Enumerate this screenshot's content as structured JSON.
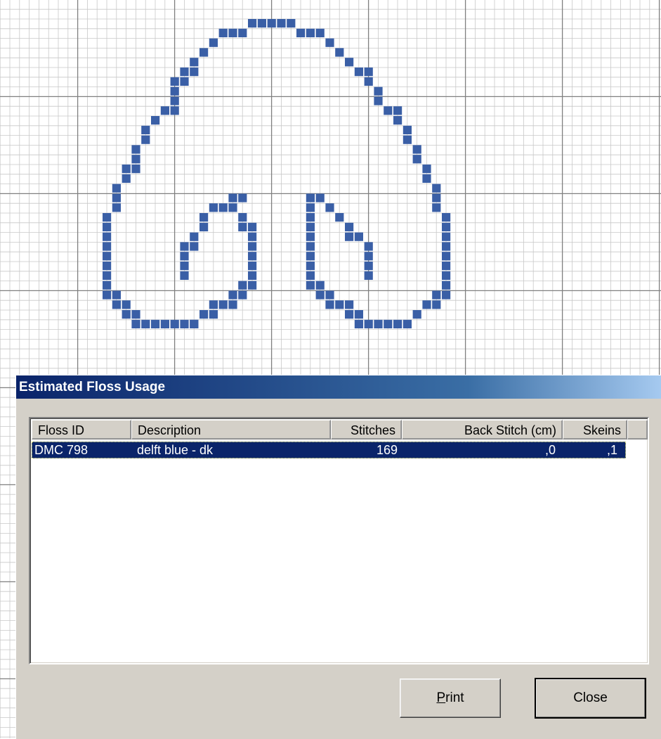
{
  "colors": {
    "stitch": "#3a5fa6",
    "grid_minor": "#c8c8c8",
    "grid_major": "#808080",
    "selection": "#0a246a",
    "face": "#d4d0c8"
  },
  "pattern": {
    "stitches": [
      [
        18,
        0
      ],
      [
        19,
        0
      ],
      [
        20,
        0
      ],
      [
        21,
        0
      ],
      [
        22,
        0
      ],
      [
        15,
        1
      ],
      [
        16,
        1
      ],
      [
        17,
        1
      ],
      [
        23,
        1
      ],
      [
        24,
        1
      ],
      [
        25,
        1
      ],
      [
        14,
        2
      ],
      [
        26,
        2
      ],
      [
        13,
        3
      ],
      [
        27,
        3
      ],
      [
        12,
        4
      ],
      [
        28,
        4
      ],
      [
        11,
        5
      ],
      [
        12,
        5
      ],
      [
        29,
        5
      ],
      [
        30,
        5
      ],
      [
        10,
        6
      ],
      [
        11,
        6
      ],
      [
        30,
        6
      ],
      [
        10,
        7
      ],
      [
        31,
        7
      ],
      [
        10,
        8
      ],
      [
        31,
        8
      ],
      [
        9,
        9
      ],
      [
        10,
        9
      ],
      [
        32,
        9
      ],
      [
        33,
        9
      ],
      [
        8,
        10
      ],
      [
        33,
        10
      ],
      [
        7,
        11
      ],
      [
        34,
        11
      ],
      [
        7,
        12
      ],
      [
        34,
        12
      ],
      [
        6,
        13
      ],
      [
        35,
        13
      ],
      [
        6,
        14
      ],
      [
        35,
        14
      ],
      [
        5,
        15
      ],
      [
        6,
        15
      ],
      [
        36,
        15
      ],
      [
        5,
        16
      ],
      [
        36,
        16
      ],
      [
        4,
        17
      ],
      [
        37,
        17
      ],
      [
        4,
        18
      ],
      [
        37,
        18
      ],
      [
        4,
        19
      ],
      [
        37,
        19
      ],
      [
        3,
        20
      ],
      [
        38,
        20
      ],
      [
        3,
        21
      ],
      [
        38,
        21
      ],
      [
        3,
        22
      ],
      [
        38,
        22
      ],
      [
        3,
        23
      ],
      [
        38,
        23
      ],
      [
        3,
        24
      ],
      [
        38,
        24
      ],
      [
        3,
        25
      ],
      [
        38,
        25
      ],
      [
        3,
        26
      ],
      [
        38,
        26
      ],
      [
        3,
        27
      ],
      [
        38,
        27
      ],
      [
        3,
        28
      ],
      [
        4,
        28
      ],
      [
        37,
        28
      ],
      [
        38,
        28
      ],
      [
        4,
        29
      ],
      [
        5,
        29
      ],
      [
        36,
        29
      ],
      [
        37,
        29
      ],
      [
        5,
        30
      ],
      [
        6,
        30
      ],
      [
        35,
        30
      ],
      [
        6,
        31
      ],
      [
        7,
        31
      ],
      [
        8,
        31
      ],
      [
        9,
        31
      ],
      [
        10,
        31
      ],
      [
        11,
        31
      ],
      [
        12,
        31
      ],
      [
        29,
        31
      ],
      [
        30,
        31
      ],
      [
        31,
        31
      ],
      [
        32,
        31
      ],
      [
        33,
        31
      ],
      [
        34,
        31
      ],
      [
        16,
        18
      ],
      [
        17,
        18
      ],
      [
        24,
        18
      ],
      [
        25,
        18
      ],
      [
        14,
        19
      ],
      [
        15,
        19
      ],
      [
        16,
        19
      ],
      [
        24,
        19
      ],
      [
        26,
        19
      ],
      [
        13,
        20
      ],
      [
        17,
        20
      ],
      [
        24,
        20
      ],
      [
        27,
        20
      ],
      [
        13,
        21
      ],
      [
        17,
        21
      ],
      [
        18,
        21
      ],
      [
        24,
        21
      ],
      [
        28,
        21
      ],
      [
        12,
        22
      ],
      [
        18,
        22
      ],
      [
        24,
        22
      ],
      [
        28,
        22
      ],
      [
        29,
        22
      ],
      [
        11,
        23
      ],
      [
        12,
        23
      ],
      [
        18,
        23
      ],
      [
        24,
        23
      ],
      [
        30,
        23
      ],
      [
        11,
        24
      ],
      [
        18,
        24
      ],
      [
        24,
        24
      ],
      [
        30,
        24
      ],
      [
        11,
        25
      ],
      [
        18,
        25
      ],
      [
        24,
        25
      ],
      [
        30,
        25
      ],
      [
        11,
        26
      ],
      [
        18,
        26
      ],
      [
        24,
        26
      ],
      [
        30,
        26
      ],
      [
        17,
        27
      ],
      [
        18,
        27
      ],
      [
        24,
        27
      ],
      [
        25,
        27
      ],
      [
        16,
        28
      ],
      [
        17,
        28
      ],
      [
        25,
        28
      ],
      [
        26,
        28
      ],
      [
        14,
        29
      ],
      [
        15,
        29
      ],
      [
        16,
        29
      ],
      [
        26,
        29
      ],
      [
        27,
        29
      ],
      [
        28,
        29
      ],
      [
        13,
        30
      ],
      [
        14,
        30
      ],
      [
        28,
        30
      ],
      [
        29,
        30
      ],
      [
        12,
        31
      ]
    ]
  },
  "dialog": {
    "title": "Estimated Floss Usage",
    "columns": {
      "floss_id": "Floss ID",
      "description": "Description",
      "stitches": "Stitches",
      "back_stitch": "Back Stitch (cm)",
      "skeins": "Skeins"
    },
    "rows": [
      {
        "floss_id": "DMC 798",
        "description": "delft blue - dk",
        "stitches": "169",
        "back_stitch": ",0",
        "skeins": ",1"
      }
    ],
    "print_button": "Print",
    "close_button": "Close"
  }
}
